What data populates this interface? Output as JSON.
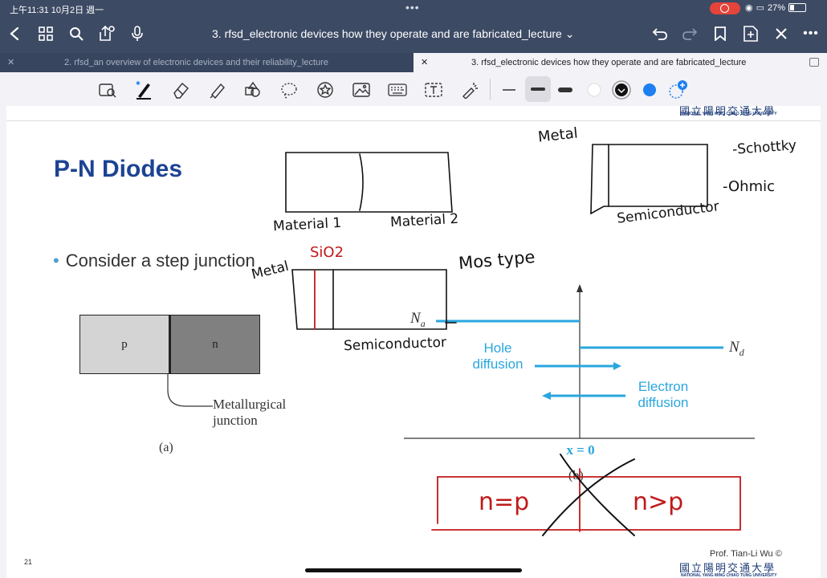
{
  "status_bar": {
    "time_date": "上午11:31  10月2日 週一",
    "battery": "27%"
  },
  "nav": {
    "document_title": "3. rfsd_electronic devices how they operate and are fabricated_lecture ⌄"
  },
  "tabs": [
    {
      "label": "2. rfsd_an overview of electronic devices and their reliability_lecture",
      "active": false
    },
    {
      "label": "3. rfsd_electronic devices how they operate and are fabricated_lecture",
      "active": true
    }
  ],
  "toolbar": {
    "tools": [
      "lasso-select",
      "pen",
      "eraser",
      "highlighter",
      "shapes",
      "lasso",
      "sticker",
      "image",
      "keyboard",
      "text-box",
      "laser-pointer"
    ],
    "colors": [
      "#ffffff",
      "#111111",
      "#1e7ff0"
    ]
  },
  "slide": {
    "title": "P-N Diodes",
    "bullet": "Consider a step junction",
    "p_label": "p",
    "n_label": "n",
    "metallurgical": "Metallurgical\njunction",
    "caption_a": "(a)",
    "na_label": "N",
    "na_sub": "a",
    "nd_label": "N",
    "nd_sub": "d",
    "hole_diffusion": "Hole\ndiffusion",
    "electron_diffusion": "Electron\ndiffusion",
    "x0_label": "x = 0",
    "caption_b": "(b)",
    "page_number": "21",
    "professor": "Prof. Tian-Li Wu ©",
    "university_cn": "國立陽明交通大學",
    "university_en": "NATIONAL YANG MING CHIAO TUNG UNIVERSITY"
  },
  "handwriting": {
    "metal_top": "Metal",
    "schottky": "-Schottky",
    "ohmic": "-Ohmic",
    "semiconductor_top": "Semiconductor",
    "material1": "Material 1",
    "material2": "Material 2",
    "sio2": "SiO2",
    "metal_mid": "Metal",
    "mos_type": "Mos type",
    "semiconductor_mid": "Semiconductor",
    "n_eq_p_left": "n=p",
    "n_gt_p_right": "n>p"
  }
}
